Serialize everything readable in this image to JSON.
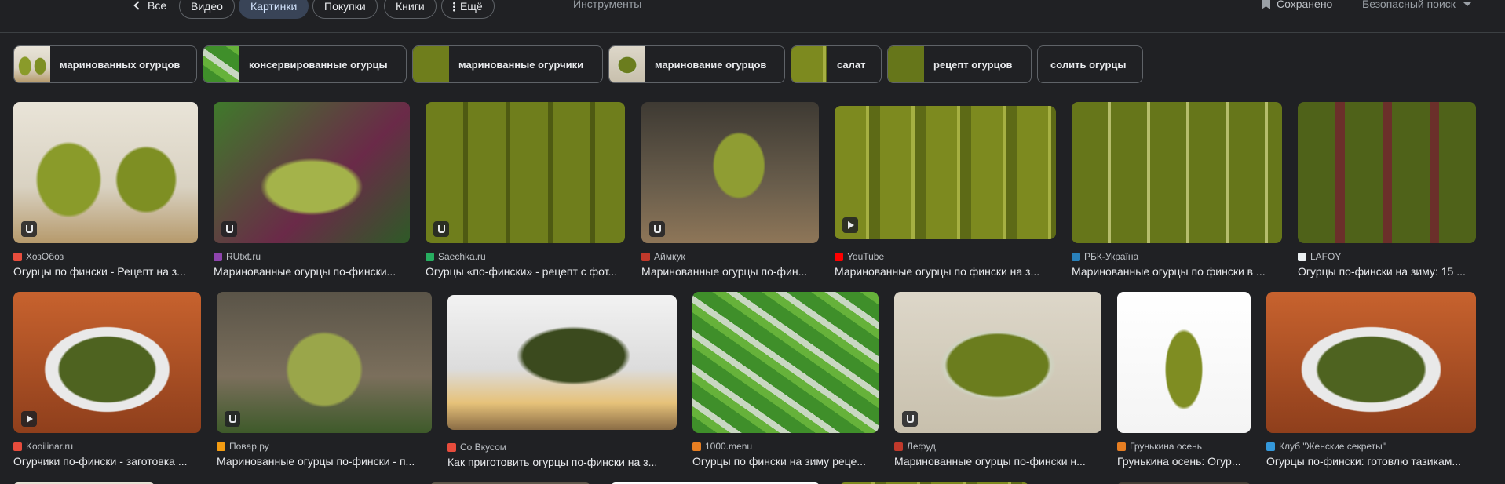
{
  "tabs": [
    {
      "label": "Все"
    },
    {
      "label": "Видео"
    },
    {
      "label": "Картинки"
    },
    {
      "label": "Покупки"
    },
    {
      "label": "Книги"
    },
    {
      "label": "Ещё"
    }
  ],
  "toolbar": {
    "tools": "Инструменты",
    "saved": "Сохранено",
    "safe_search": "Безопасный поиск"
  },
  "chips": [
    {
      "label": "маринованных огурцов"
    },
    {
      "label": "консервированные огурцы"
    },
    {
      "label": "маринованные огурчики"
    },
    {
      "label": "маринование огурцов"
    },
    {
      "label": "салат"
    },
    {
      "label": "рецепт огурцов"
    },
    {
      "label": "солить огурцы"
    }
  ],
  "results": [
    {
      "source": "ХозОбоз",
      "title": "Огурцы по фински - Рецепт на з...",
      "favicon_color": "#e84d3d",
      "badge": "recipe"
    },
    {
      "source": "RUtxt.ru",
      "title": "Маринованные огурцы по-фински...",
      "favicon_color": "#8e44ad",
      "badge": "recipe"
    },
    {
      "source": "Saechka.ru",
      "title": "Огурцы «по-фински» - рецепт с фот...",
      "favicon_color": "#27ae60",
      "badge": "recipe"
    },
    {
      "source": "Аймкук",
      "title": "Маринованные огурцы по-фин...",
      "favicon_color": "#c0392b",
      "badge": "recipe"
    },
    {
      "source": "YouTube",
      "title": "Маринованные огурцы по фински на з...",
      "favicon_color": "#ff0000",
      "badge": "video"
    },
    {
      "source": "РБК-Україна",
      "title": "Маринованные огурцы по фински в ...",
      "favicon_color": "#2980b9",
      "badge": "none"
    },
    {
      "source": "LAFOY",
      "title": "Огурцы по-фински на зиму: 15 ...",
      "favicon_color": "#ecf0f1",
      "badge": "none"
    },
    {
      "source": "Kooilinar.ru",
      "title": "Огурчики по-фински - заготовка ...",
      "favicon_color": "#e74c3c",
      "badge": "video"
    },
    {
      "source": "Повар.ру",
      "title": "Маринованные огурцы по-фински - п...",
      "favicon_color": "#f39c12",
      "badge": "recipe"
    },
    {
      "source": "Со Вкусом",
      "title": "Как приготовить огурцы по-фински на з...",
      "favicon_color": "#e74c3c",
      "badge": "none"
    },
    {
      "source": "1000.menu",
      "title": "Огурцы по фински на зиму реце...",
      "favicon_color": "#e67e22",
      "badge": "none"
    },
    {
      "source": "Лефуд",
      "title": "Маринованные огурцы по-фински н...",
      "favicon_color": "#c0392b",
      "badge": "recipe"
    },
    {
      "source": "Грунькина осень",
      "title": "Грунькина осень: Огур...",
      "favicon_color": "#e67e22",
      "badge": "none"
    },
    {
      "source": "Клуб \"Женские секреты\"",
      "title": "Огурцы по-фински: готовлю тазикам...",
      "favicon_color": "#3498db",
      "badge": "none"
    }
  ]
}
